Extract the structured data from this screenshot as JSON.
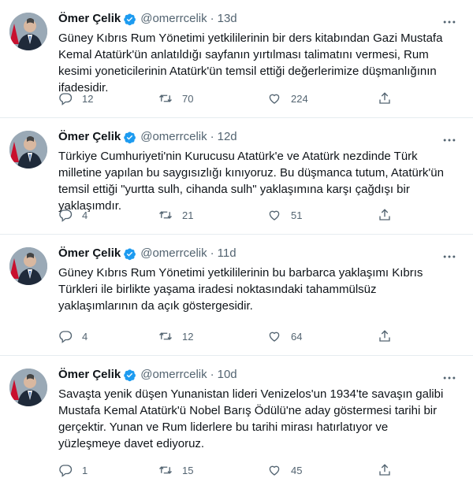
{
  "tweets": [
    {
      "name": "Ömer Çelik",
      "handle": "@omerrcelik",
      "dot": "·",
      "time": "13d",
      "text": "Güney Kıbrıs Rum Yönetimi yetkililerinin bir ders kitabından Gazi Mustafa Kemal Atatürk'ün anlatıldığı sayfanın yırtılması talimatını vermesi, Rum kesimi yoneticilerinin Atatürk'ün temsil ettiği değerlerimize düşmanlığının ifadesidir.",
      "replies": "12",
      "retweets": "70",
      "likes": "224"
    },
    {
      "name": "Ömer Çelik",
      "handle": "@omerrcelik",
      "dot": "·",
      "time": "12d",
      "text": "Türkiye Cumhuriyeti'nin Kurucusu Atatürk'e ve Atatürk nezdinde Türk milletine yapılan bu saygısızlığı kınıyoruz. Bu düşmanca tutum, Atatürk'ün temsil ettiği \"yurtta sulh, cihanda sulh\" yaklaşımına karşı çağdışı bir yaklaşımdır.",
      "replies": "4",
      "retweets": "21",
      "likes": "51"
    },
    {
      "name": "Ömer Çelik",
      "handle": "@omerrcelik",
      "dot": "·",
      "time": "11d",
      "text": "Güney Kıbrıs Rum Yönetimi yetkililerinin bu barbarca yaklaşımı Kıbrıs Türkleri ile birlikte yaşama iradesi noktasındaki tahammülsüz yaklaşımlarının da açık göstergesidir.",
      "replies": "4",
      "retweets": "12",
      "likes": "64"
    },
    {
      "name": "Ömer Çelik",
      "handle": "@omerrcelik",
      "dot": "·",
      "time": "10d",
      "text": "Savaşta yenik düşen Yunanistan lideri Venizelos'un 1934'te savaşın galibi Mustafa Kemal Atatürk'ü Nobel Barış Ödülü'ne aday göstermesi tarihi bir gerçektir. Yunan ve Rum liderlere bu tarihi mirası hatırlatıyor ve yüzleşmeye davet ediyoruz.",
      "replies": "1",
      "retweets": "15",
      "likes": "45"
    }
  ],
  "colors": {
    "verified": "#1d9bf0",
    "secondary_text": "#536471",
    "divider": "#e6ecf0"
  },
  "icons": [
    "verified-badge-icon",
    "more-icon",
    "reply-icon",
    "retweet-icon",
    "like-icon",
    "share-icon"
  ]
}
